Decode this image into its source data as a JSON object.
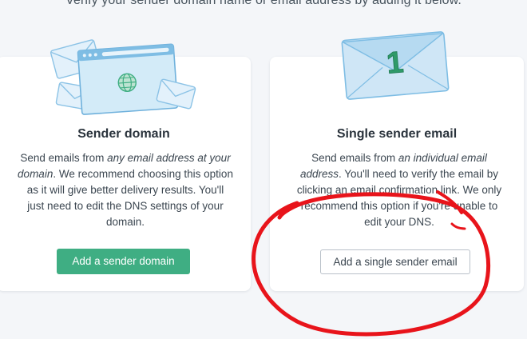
{
  "intro_text": "Verify your sender domain name or email address by adding it below.",
  "sender_domain": {
    "title": "Sender domain",
    "desc_a": "Send emails from ",
    "desc_em1": "any email address at your domain",
    "desc_b": ". We recommend choosing this option as it will give better delivery results. You'll just need to edit the DNS settings of your domain.",
    "button_label": "Add a sender domain",
    "button_color": "#3fae83"
  },
  "single_sender": {
    "title": "Single sender email",
    "desc_a": "Send emails from ",
    "desc_em1": "an individual email address",
    "desc_b": ". You'll need to verify the email by clicking an email confirmation link. We only recommend this option if you're unable to edit your DNS.",
    "button_label": "Add a single sender email",
    "envelope_badge": "1"
  },
  "annotation": {
    "color": "#e8141b",
    "shape": "hand-drawn circle around single sender button"
  },
  "icons": {
    "left_illustration": "browser-window-with-envelopes",
    "right_illustration": "envelope-with-number-one"
  }
}
